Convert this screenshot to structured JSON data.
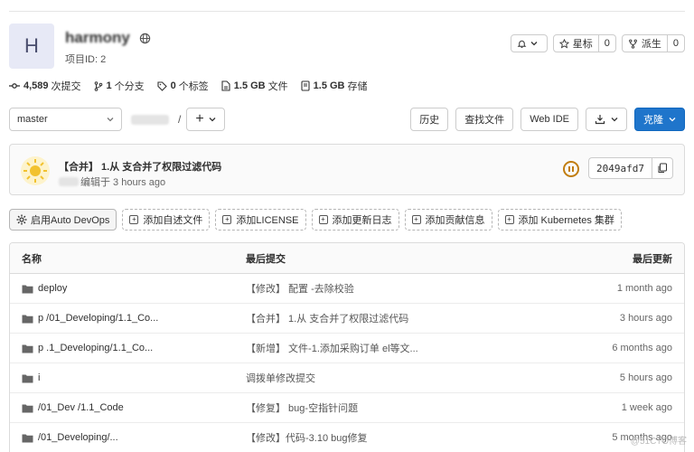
{
  "project": {
    "avatar_letter": "H",
    "name": "harmony",
    "id_label": "项目ID: 2"
  },
  "header_actions": {
    "notify_icon": "bell-icon",
    "star_label": "星标",
    "star_count": "0",
    "fork_label": "派生",
    "fork_count": "0"
  },
  "stats": {
    "commits_count": "4,589",
    "commits_label": "次提交",
    "branches_count": "1",
    "branches_label": "个分支",
    "tags_count": "0",
    "tags_label": "个标签",
    "files_size": "1.5 GB",
    "files_label": "文件",
    "storage_size": "1.5 GB",
    "storage_label": "存储"
  },
  "toolbar": {
    "branch": "master",
    "path_separator": "/",
    "history": "历史",
    "find_file": "查找文件",
    "web_ide": "Web IDE",
    "clone": "克隆"
  },
  "commit": {
    "title": "【合并】 1.从          支合并了权限过滤代码",
    "meta": "编辑于 3 hours ago",
    "sha": "2049afd7"
  },
  "quick_actions": [
    {
      "label": "启用Auto DevOps"
    },
    {
      "label": "添加自述文件"
    },
    {
      "label": "添加LICENSE"
    },
    {
      "label": "添加更新日志"
    },
    {
      "label": "添加贡献信息"
    },
    {
      "label": "添加 Kubernetes 集群"
    }
  ],
  "table": {
    "headers": {
      "name": "名称",
      "last_commit": "最后提交",
      "last_update": "最后更新"
    },
    "rows": [
      {
        "name": "deploy",
        "commit": "【修改】 配置 -去除校验",
        "time": "1 month ago"
      },
      {
        "name": "p        /01_Developing/1.1_Co...",
        "commit": "【合并】 1.从        支合并了权限过滤代码",
        "time": "3 hours ago"
      },
      {
        "name": "p          .1_Developing/1.1_Co...",
        "commit": "【新增】 文件-1.添加采购订单          el等文...",
        "time": "6 months ago"
      },
      {
        "name": "         i",
        "commit": "调拨单修改提交",
        "time": "5 hours ago"
      },
      {
        "name": "        /01_Dev        /1.1_Code",
        "commit": "【修复】 bug-空指针问题",
        "time": "1 week ago"
      },
      {
        "name": "                 /01_Developing/...",
        "commit": "【修改】代码-3.10 bug修复",
        "time": "5 months ago"
      }
    ]
  },
  "watermark": "@51CTO博客"
}
